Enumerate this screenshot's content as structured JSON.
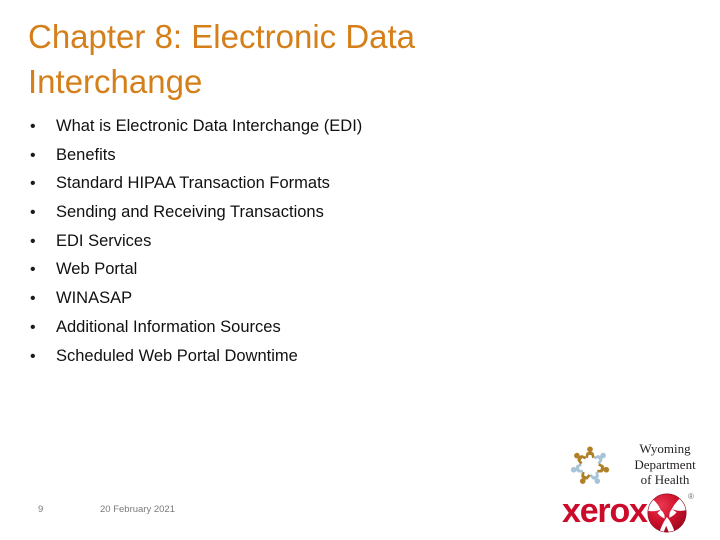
{
  "slide": {
    "title": "Chapter 8: Electronic Data Interchange",
    "bullet_marker": "•",
    "bullets": [
      {
        "text": "What is Electronic Data Interchange (EDI)"
      },
      {
        "text": "Benefits"
      },
      {
        "text": "Standard HIPAA Transaction Formats"
      },
      {
        "text": "Sending and Receiving Transactions"
      },
      {
        "text": "EDI Services"
      },
      {
        "text": "Web Portal"
      },
      {
        "text": "WINASAP"
      },
      {
        "text": "Additional Information Sources"
      },
      {
        "text": "Scheduled Web Portal Downtime"
      }
    ]
  },
  "footer": {
    "slide_number": "9",
    "date": "20 February 2021"
  },
  "logos": {
    "wyoming_department_of_health": {
      "emblem_icon": "people-circle-icon",
      "line1": "Wyoming",
      "line2": "Department",
      "line3": "of Health",
      "color_tan": "#b08029",
      "color_blue": "#a8c4d8"
    },
    "xerox": {
      "wordmark": "xerox",
      "sphere_icon": "xerox-sphere-icon",
      "registered_mark": "®",
      "color_red": "#cc0b2a"
    }
  },
  "colors": {
    "title_orange": "#d47f19",
    "body_text": "#111111",
    "footer_gray": "#7a7a7a",
    "background": "#ffffff"
  }
}
